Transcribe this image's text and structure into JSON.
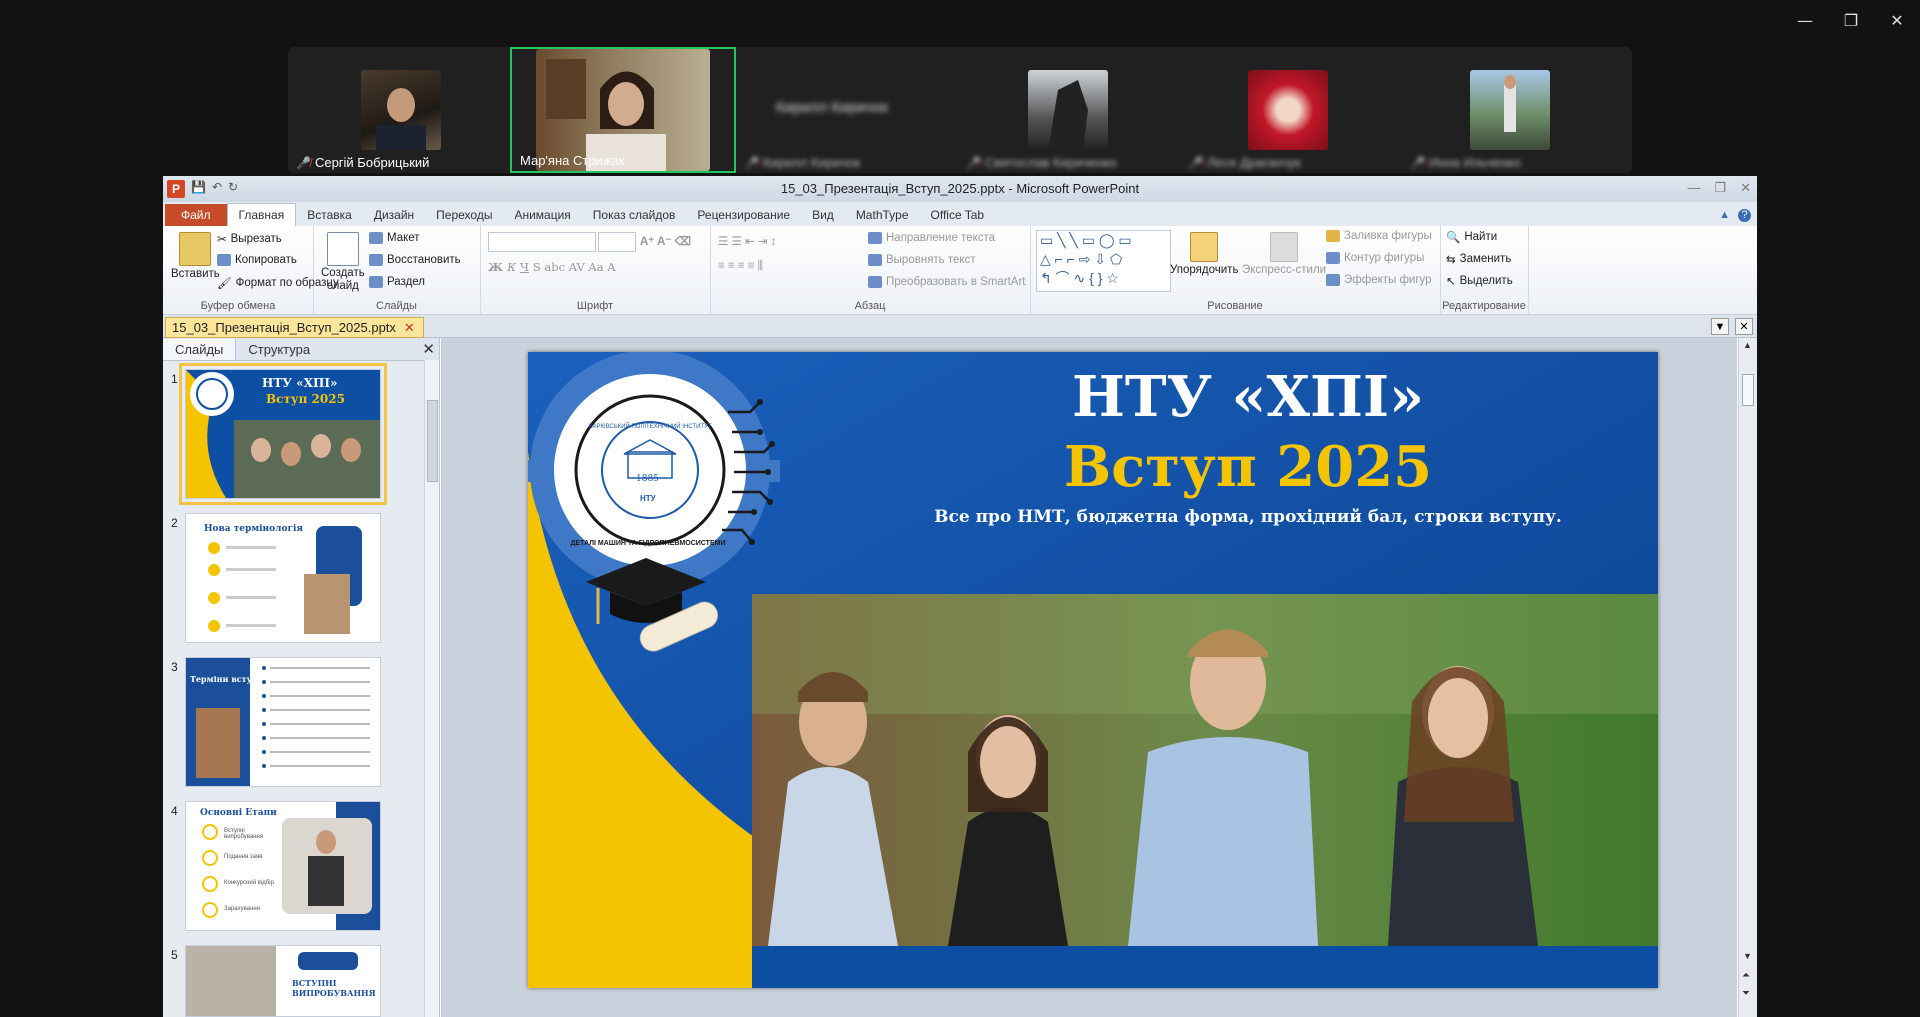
{
  "meeting": {
    "participants": [
      {
        "name": "Сергій Бобрицький",
        "active": false,
        "blurred": false
      },
      {
        "name": "Мар'яна Стрижак",
        "active": true,
        "blurred": false
      },
      {
        "name": "Кирилл Киричок",
        "active": false,
        "blurred": true,
        "placeholder": "Кирилл Киричок"
      },
      {
        "name": "Святослав Кириченко",
        "active": false,
        "blurred": true
      },
      {
        "name": "Леся Драганчук",
        "active": false,
        "blurred": true
      },
      {
        "name": "Инна Ильченко",
        "active": false,
        "blurred": true
      }
    ]
  },
  "window": {
    "title": "15_03_Презентація_Вступ_2025.pptx - Microsoft PowerPoint",
    "app_icon": "P"
  },
  "ribbon": {
    "tabs": [
      "Файл",
      "Главная",
      "Вставка",
      "Дизайн",
      "Переходы",
      "Анимация",
      "Показ слайдов",
      "Рецензирование",
      "Вид",
      "MathType",
      "Office Tab"
    ],
    "active_tab": "Главная",
    "clipboard": {
      "paste": "Вставить",
      "cut": "Вырезать",
      "copy": "Копировать",
      "format_painter": "Формат по образцу",
      "group": "Буфер обмена"
    },
    "slides": {
      "new_slide_1": "Создать",
      "new_slide_2": "слайд",
      "layout": "Макет",
      "reset": "Восстановить",
      "section": "Раздел",
      "group": "Слайды"
    },
    "font": {
      "group": "Шрифт"
    },
    "paragraph": {
      "text_direction": "Направление текста",
      "align_text": "Выровнять текст",
      "smartart": "Преобразовать в SmartArt",
      "group": "Абзац"
    },
    "drawing": {
      "arrange": "Упорядочить",
      "quick_styles": "Экспресс-стили",
      "shape_fill": "Заливка фигуры",
      "shape_outline": "Контур фигуры",
      "shape_effects": "Эффекты фигур",
      "group": "Рисование"
    },
    "editing": {
      "find": "Найти",
      "replace": "Заменить",
      "select": "Выделить",
      "group": "Редактирование"
    }
  },
  "document_tab": "15_03_Презентація_Вступ_2025.pptx",
  "slide_pane": {
    "tabs": [
      "Слайды",
      "Структура"
    ],
    "thumbnails": [
      {
        "num": "1",
        "title": "НТУ «ХПІ»",
        "subtitle": "Вступ 2025"
      },
      {
        "num": "2",
        "title": "Нова термінологія"
      },
      {
        "num": "3",
        "title": "Терміни вступу"
      },
      {
        "num": "4",
        "title": "Основні Етапи",
        "items": [
          "Вступні випробування",
          "Подання заяв",
          "Конкурсний відбір",
          "Зарахування"
        ]
      },
      {
        "num": "5",
        "title": "ВСТУПНІ ВИПРОБУВАННЯ"
      }
    ]
  },
  "slide": {
    "title": "НТУ «ХПІ»",
    "subtitle": "Вступ 2025",
    "tagline": "Все про НМТ, бюджетна форма, прохідний бал, строки вступу.",
    "logo_text": "ДЕТАЛІ МАШИН ТА ГІДРОПНЕВМОСИСТЕМИ",
    "logo_inner": "ХАРКІВСЬКИЙ ПОЛІТЕХНІЧНИЙ ІНСТИТУТ",
    "logo_year": "1885",
    "logo_ntu": "НТУ"
  },
  "colors": {
    "blue": "#0b4ea2",
    "yellow": "#f5c400",
    "accent": "#c64b2a"
  }
}
